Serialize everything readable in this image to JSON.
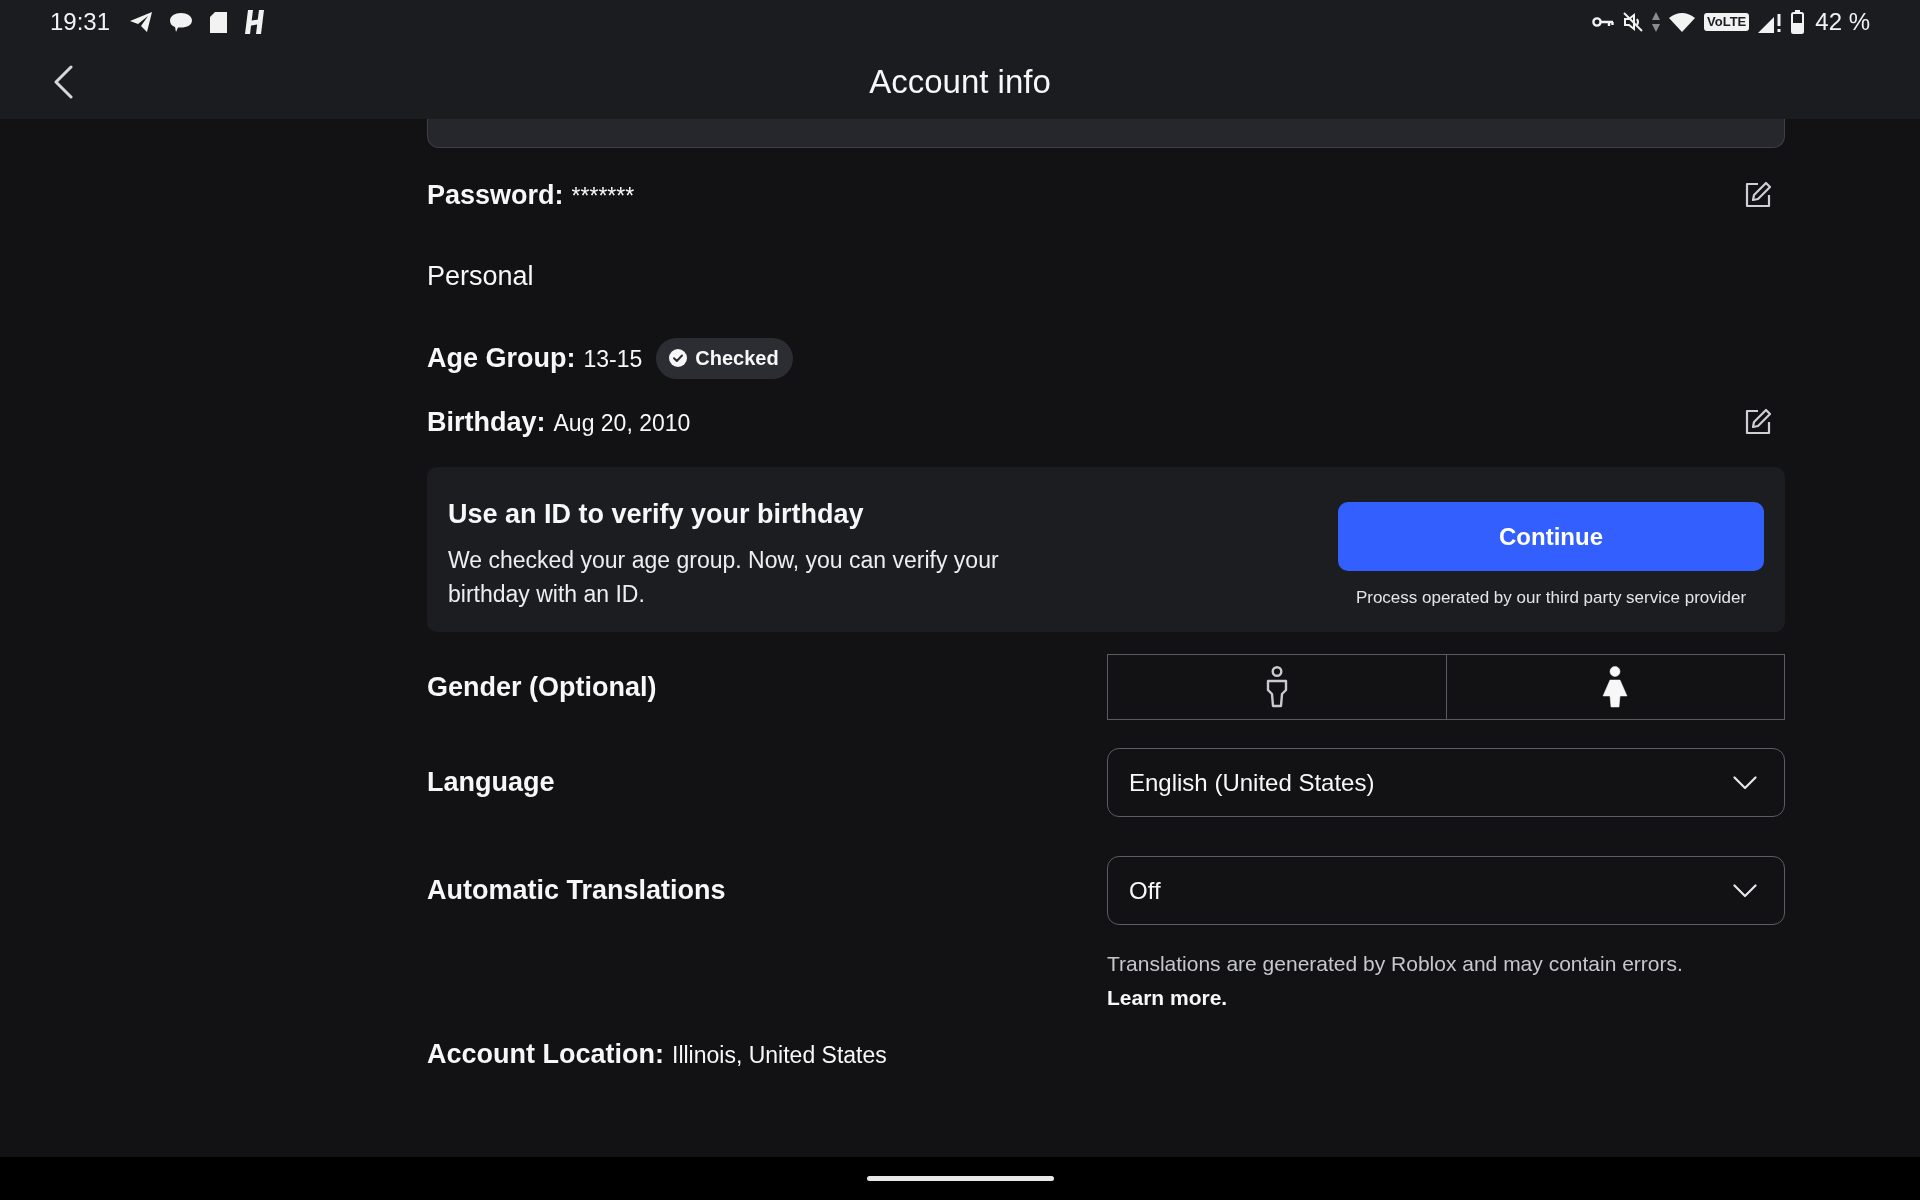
{
  "status_bar": {
    "time": "19:31",
    "network_badge": "VoLTE",
    "battery": "42 %"
  },
  "header": {
    "title": "Account info"
  },
  "password": {
    "label": "Password:",
    "value": "*******"
  },
  "section_heading": "Personal",
  "age_group": {
    "label": "Age Group:",
    "value": "13-15",
    "tag": "Checked"
  },
  "birthday": {
    "label": "Birthday:",
    "value": "Aug 20, 2010"
  },
  "verify_card": {
    "title": "Use an ID to verify your birthday",
    "body": "We checked your age group. Now, you can verify your birthday with an ID.",
    "button": "Continue",
    "note": "Process operated by our third party service provider"
  },
  "gender": {
    "label": "Gender (Optional)",
    "options": [
      {
        "kind": "male",
        "selected": false
      },
      {
        "kind": "female",
        "selected": true
      }
    ]
  },
  "language": {
    "label": "Language",
    "value": "English (United States)"
  },
  "translations": {
    "label": "Automatic Translations",
    "value": "Off",
    "note": "Translations are generated by Roblox and may contain errors.",
    "link": "Learn more."
  },
  "location": {
    "label": "Account Location:",
    "value": "Illinois, United States"
  }
}
